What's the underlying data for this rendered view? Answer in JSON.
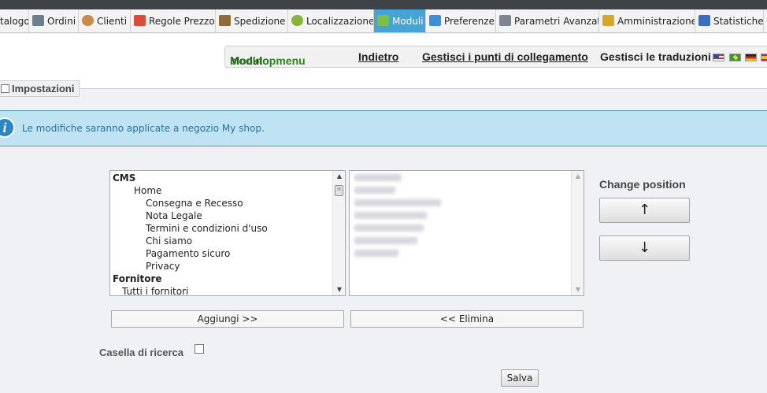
{
  "nav": {
    "tabs": [
      {
        "label": "talogo",
        "icon": null,
        "color": null
      },
      {
        "label": "Ordini",
        "icon": "cart-icon",
        "color": "#6d7e8c"
      },
      {
        "label": "Clienti",
        "icon": "user-icon",
        "color": "#c98a4a"
      },
      {
        "label": "Regole Prezzo",
        "icon": "price-tag-icon",
        "color": "#d94b3a"
      },
      {
        "label": "Spedizione",
        "icon": "truck-icon",
        "color": "#8d6b3a"
      },
      {
        "label": "Localizzazione",
        "icon": "globe-icon",
        "color": "#86b53a"
      },
      {
        "label": "Moduli",
        "icon": "puzzle-icon",
        "color": "#7bc043"
      },
      {
        "label": "Preferenze",
        "icon": "preferences-icon",
        "color": "#3f8ed6"
      },
      {
        "label": "Parametri Avanzati",
        "icon": "wrench-icon",
        "color": "#7c8591"
      },
      {
        "label": "Amministrazione",
        "icon": "key-icon",
        "color": "#d4a62a"
      },
      {
        "label": "Statistiche",
        "icon": "stats-icon",
        "color": "#3a6fc4"
      },
      {
        "label": "",
        "icon": null,
        "color": null
      }
    ],
    "active_tab": "Moduli"
  },
  "toolbar": {
    "module_prefix": "Modulo",
    "module_name": "blocktopmenu",
    "back_label": "Indietro",
    "hooks_label": "Gestisci i punti di collegamento",
    "translations_label": "Gestisci le traduzioni",
    "flags": [
      "us-flag-icon",
      "br-flag-icon",
      "de-flag-icon",
      "es-flag-icon"
    ]
  },
  "settings": {
    "legend": "Impostazioni"
  },
  "info": {
    "message": "Le modifiche saranno applicate a negozio My shop."
  },
  "available_items": [
    {
      "label": "CMS",
      "level": 0,
      "group": true
    },
    {
      "label": "Home",
      "level": 1,
      "group": false
    },
    {
      "label": "Consegna e Recesso",
      "level": 2,
      "group": false
    },
    {
      "label": "Nota Legale",
      "level": 2,
      "group": false
    },
    {
      "label": "Termini e condizioni d'uso",
      "level": 2,
      "group": false
    },
    {
      "label": "Chi siamo",
      "level": 2,
      "group": false
    },
    {
      "label": "Pagamento sicuro",
      "level": 2,
      "group": false
    },
    {
      "label": "Privacy",
      "level": 2,
      "group": false
    },
    {
      "label": "Fornitore",
      "level": 0,
      "group": true
    },
    {
      "label": "Tutti i fornitori",
      "level": 1,
      "group": false
    }
  ],
  "selected_items_count": 7,
  "buttons": {
    "add": "Aggiungi >>",
    "remove": "<< Elimina",
    "change_position": "Change position",
    "up": "↑",
    "down": "↓",
    "save": "Salva"
  },
  "search_box": {
    "label": "Casella di ricerca",
    "checked": false
  }
}
